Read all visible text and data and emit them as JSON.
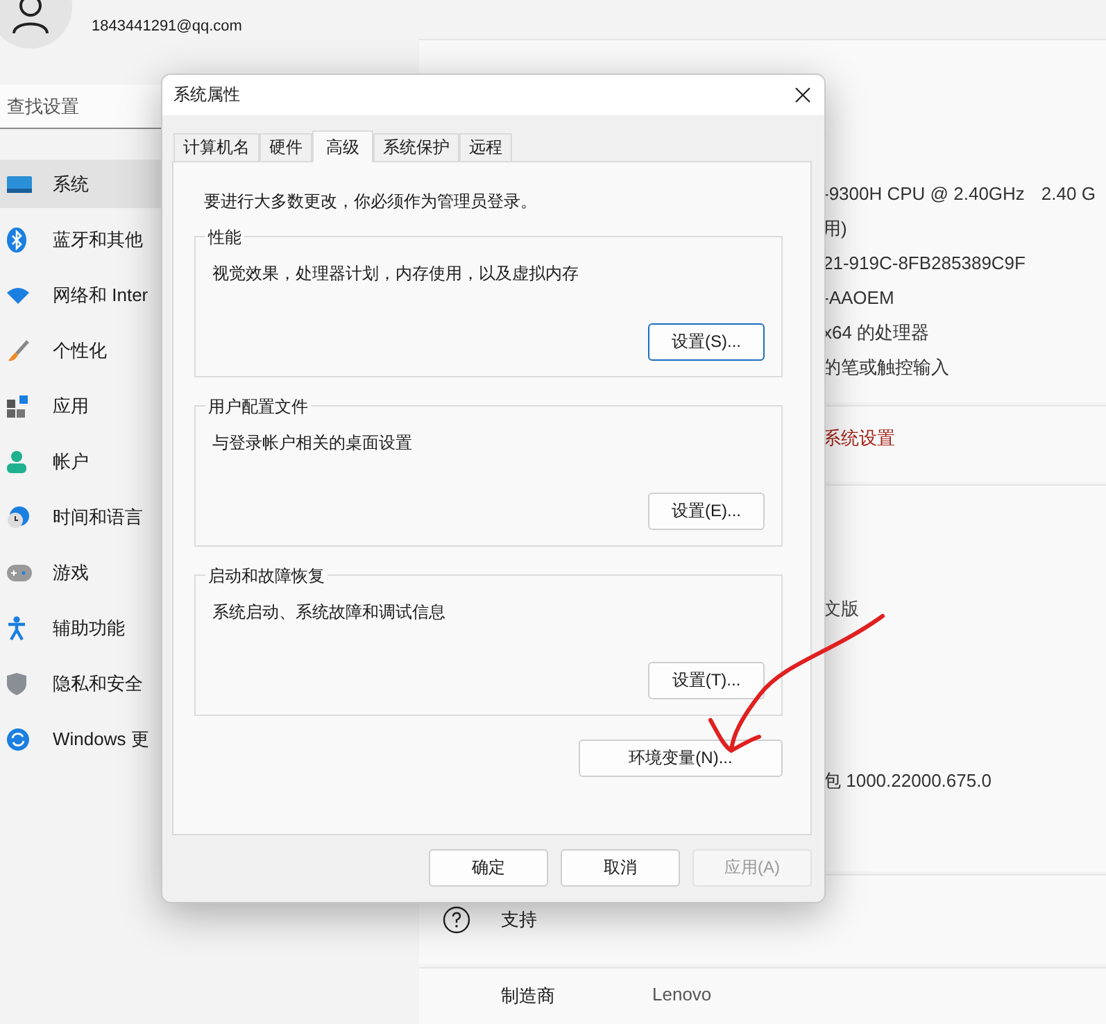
{
  "settings": {
    "user": {
      "email": "1843441291@qq.com"
    },
    "search": {
      "placeholder": "查找设置"
    },
    "nav": [
      {
        "label": "系统",
        "selected": true
      },
      {
        "label": "蓝牙和其他",
        "selected": false
      },
      {
        "label": "网络和 Inter",
        "selected": false
      },
      {
        "label": "个性化",
        "selected": false
      },
      {
        "label": "应用",
        "selected": false
      },
      {
        "label": "帐户",
        "selected": false
      },
      {
        "label": "时间和语言",
        "selected": false
      },
      {
        "label": "游戏",
        "selected": false
      },
      {
        "label": "辅助功能",
        "selected": false
      },
      {
        "label": "隐私和安全",
        "selected": false
      },
      {
        "label": "Windows 更",
        "selected": false
      }
    ],
    "spec_rows": [
      {
        "value": "-9300H CPU @ 2.40GHz",
        "extra": "2.40 G"
      },
      {
        "value": "用)"
      },
      {
        "value": "21-919C-8FB285389C9F"
      },
      {
        "value": "-AAOEM"
      },
      {
        "value": "x64 的处理器"
      },
      {
        "value": "的笔或触控输入"
      }
    ],
    "link": "系统设置",
    "windows_rows": [
      "文版",
      "包 1000.22000.675.0"
    ],
    "support": {
      "title": "支持",
      "rows": [
        {
          "label": "制造商",
          "value": "Lenovo"
        }
      ]
    }
  },
  "dialog": {
    "title": "系统属性",
    "tabs": [
      {
        "label": "计算机名",
        "selected": false
      },
      {
        "label": "硬件",
        "selected": false
      },
      {
        "label": "高级",
        "selected": true
      },
      {
        "label": "系统保护",
        "selected": false
      },
      {
        "label": "远程",
        "selected": false
      }
    ],
    "notice": "要进行大多数更改，你必须作为管理员登录。",
    "groups": [
      {
        "title": "性能",
        "description": "视觉效果，处理器计划，内存使用，以及虚拟内存",
        "button": "设置(S)...",
        "default": true
      },
      {
        "title": "用户配置文件",
        "description": "与登录帐户相关的桌面设置",
        "button": "设置(E)...",
        "default": false
      },
      {
        "title": "启动和故障恢复",
        "description": "系统启动、系统故障和调试信息",
        "button": "设置(T)...",
        "default": false
      }
    ],
    "env_button": "环境变量(N)...",
    "buttons": [
      {
        "label": "确定",
        "disabled": false
      },
      {
        "label": "取消",
        "disabled": false
      },
      {
        "label": "应用(A)",
        "disabled": true
      }
    ]
  }
}
